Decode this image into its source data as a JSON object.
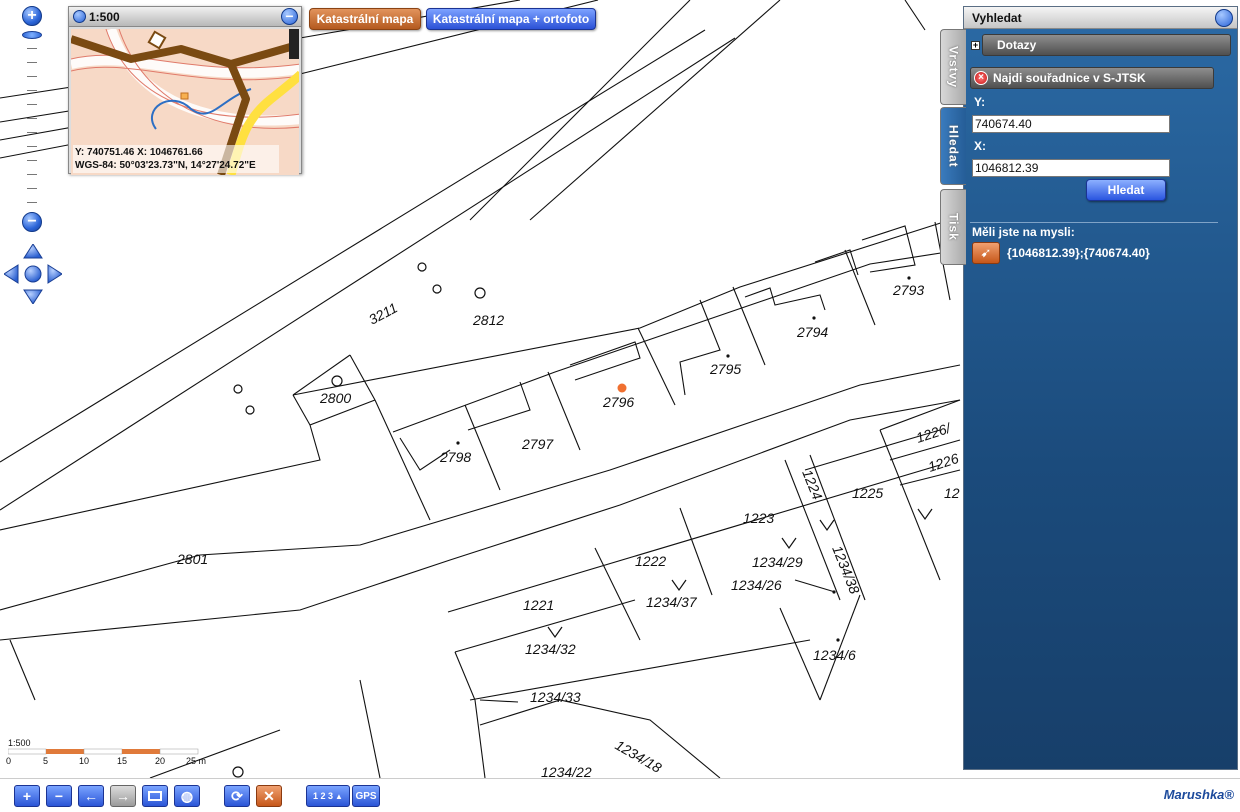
{
  "map": {
    "parcels": [
      {
        "label": "3211"
      },
      {
        "label": "2812"
      },
      {
        "label": "2800"
      },
      {
        "label": "2801"
      },
      {
        "label": "2798"
      },
      {
        "label": "2797"
      },
      {
        "label": "2796"
      },
      {
        "label": "2795"
      },
      {
        "label": "2794"
      },
      {
        "label": "2793"
      },
      {
        "label": "1226/"
      },
      {
        "label": "1226"
      },
      {
        "label": "12"
      },
      {
        "label": "1225"
      },
      {
        "label": "1224"
      },
      {
        "label": "1223"
      },
      {
        "label": "1234/29"
      },
      {
        "label": "1234/38"
      },
      {
        "label": "1222"
      },
      {
        "label": "1234/37"
      },
      {
        "label": "1234/26"
      },
      {
        "label": "1221"
      },
      {
        "label": "1234/32"
      },
      {
        "label": "1234/6"
      },
      {
        "label": "1234/33"
      },
      {
        "label": "1234/18"
      },
      {
        "label": "1234/22"
      }
    ],
    "marker_color": "#f07030"
  },
  "zoom": {
    "plus": "+",
    "minus": "−"
  },
  "overview": {
    "scale": "1:500",
    "coords_line1": "Y: 740751.46 X: 1046761.66",
    "coords_line2": "WGS-84: 50°03'23.73\"N, 14°27'24.72\"E"
  },
  "map_types": {
    "katastr": "Katastrální mapa",
    "orto": "Katastrální mapa + ortofoto"
  },
  "panel": {
    "title": "Vyhledat",
    "tabs": [
      "Vrstvy",
      "Hledat",
      "Tisk"
    ],
    "dotazy": "Dotazy",
    "dotazy_icon": "+",
    "search_title": "Najdi souřadnice v S-JTSK",
    "label_y": "Y:",
    "value_y": "740674.40",
    "label_x": "X:",
    "value_x": "1046812.39",
    "search_button": "Hledat",
    "suggest_title": "Měli jste na mysli:",
    "suggest_item": "{1046812.39};{740674.40}"
  },
  "scalebar": {
    "scale": "1:500",
    "ticks": [
      "0",
      "5",
      "10",
      "15",
      "20",
      "25 m"
    ]
  },
  "toolbar": {
    "brand": "Marushka®",
    "gps": "GPS",
    "digits": "1 2 3"
  },
  "colors": {
    "panel_blue": "#1b4b7c",
    "button_blue": "#2b55d6",
    "button_orange": "#c6571a"
  }
}
